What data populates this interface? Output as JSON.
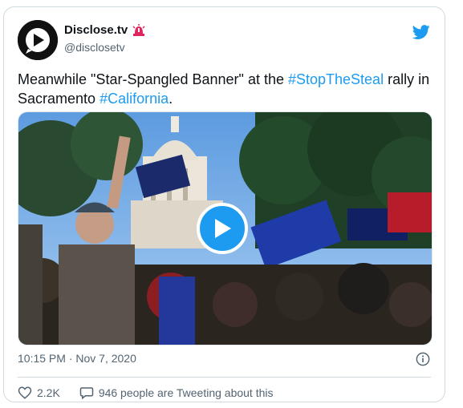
{
  "tweet": {
    "author_name": "Disclose.tv",
    "author_handle": "@disclosetv",
    "text_pre": "Meanwhile \"Star-Spangled Banner\" at the ",
    "hashtag1": "#StopTheSteal",
    "text_mid": " rally in Sacramento ",
    "hashtag2": "#California",
    "text_post": ".",
    "timestamp": "10:15 PM · Nov 7, 2020",
    "likes": "2.2K",
    "discussion": "946 people are Tweeting about this"
  },
  "colors": {
    "accent": "#1d9bf0",
    "muted_text": "#536471"
  },
  "icons": {
    "brand": "twitter-bird-icon",
    "play": "play-icon",
    "info": "info-icon",
    "like": "heart-icon",
    "reply": "speech-bubble-icon",
    "badge": "siren-icon"
  }
}
